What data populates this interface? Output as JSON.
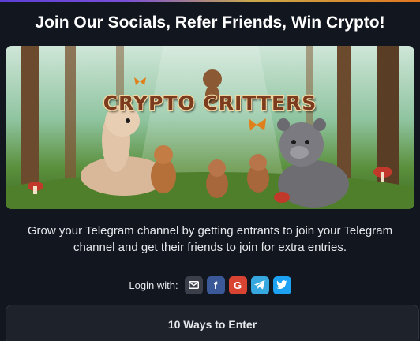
{
  "header": {
    "title": "Join Our Socials, Refer Friends, Win Crypto!",
    "accent_gradient": [
      "#5b3fd6",
      "#c9a94a",
      "#e0761e"
    ]
  },
  "banner": {
    "logo_text": "CRYPTO CRITTERS"
  },
  "description": "Grow your Telegram channel by getting entrants to join your Telegram channel and get their friends to join for extra entries.",
  "login": {
    "label": "Login with:",
    "providers": [
      {
        "name": "email",
        "icon": "envelope-icon",
        "color": "#3b3f4a"
      },
      {
        "name": "facebook",
        "icon": "facebook-icon",
        "glyph": "f",
        "color": "#3b5998"
      },
      {
        "name": "google",
        "icon": "google-icon",
        "glyph": "G",
        "color": "#d94332"
      },
      {
        "name": "telegram",
        "icon": "telegram-icon",
        "color": "#37a8df"
      },
      {
        "name": "twitter",
        "icon": "twitter-icon",
        "color": "#1da1f2"
      }
    ]
  },
  "entries": {
    "title": "10 Ways to Enter"
  }
}
